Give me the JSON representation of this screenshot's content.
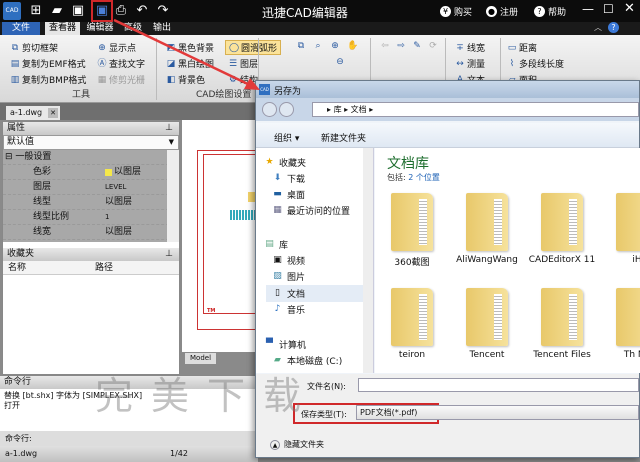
{
  "app": {
    "title": "迅捷CAD编辑器",
    "logo": "CAD",
    "buy": "购买",
    "register": "注册",
    "help": "帮助"
  },
  "quick_access": [
    "new-icon",
    "open-icon",
    "save-icon",
    "save-as-icon",
    "print-icon",
    "undo-icon",
    "redo-icon"
  ],
  "tabs": [
    "文件",
    "查看器",
    "编辑器",
    "高级",
    "输出"
  ],
  "ribbon": {
    "tools": {
      "label": "工具",
      "items": [
        "剪切框架",
        "显示点",
        "复制为EMF格式",
        "查找文字",
        "复制为BMP格式",
        "修剪光栅"
      ]
    },
    "cad_settings": {
      "label": "CAD绘图设置",
      "items": [
        "黑色背景",
        "圆滑弧形",
        "黑白绘图",
        "图层",
        "背景色",
        "结构"
      ]
    },
    "line_tools": [
      "线宽",
      "测量",
      "文本"
    ],
    "measure_tools": [
      "距离",
      "多段线长度",
      "面积"
    ]
  },
  "document_tab": "a-1.dwg",
  "properties": {
    "title": "属性",
    "dropdown": "默认值",
    "section": "一般设置",
    "rows": [
      {
        "name": "色彩",
        "value": "以图层"
      },
      {
        "name": "图层",
        "value": "LEVEL"
      },
      {
        "name": "线型",
        "value": "以图层"
      },
      {
        "name": "线型比例",
        "value": "1"
      },
      {
        "name": "线宽",
        "value": "以图层"
      }
    ]
  },
  "favorites": {
    "title": "收藏夹",
    "col_name": "名称",
    "col_path": "路径"
  },
  "drawing": {
    "model_tab": "Model",
    "stamp": "TM"
  },
  "command": {
    "title": "命令行",
    "lines": [
      "替换 [bt.shx] 字体为 [SIMPLEX.SHX]",
      "打开"
    ],
    "prompt": "命令行:"
  },
  "status": {
    "file": "a-1.dwg",
    "page": "1/42"
  },
  "watermark": "完美下载",
  "dialog": {
    "title": "另存为",
    "logo": "CAD",
    "breadcrumb": [
      "库",
      "文档"
    ],
    "organize": "组织 ▾",
    "new_folder": "新建文件夹",
    "nav": {
      "favorites": "收藏夹",
      "downloads": "下载",
      "desktop": "桌面",
      "recent": "最近访问的位置",
      "libraries": "库",
      "videos": "视频",
      "pictures": "图片",
      "documents": "文档",
      "music": "音乐",
      "computer": "计算机",
      "local_disk": "本地磁盘 (C:)"
    },
    "library_title": "文档库",
    "library_sub_label": "包括:",
    "library_sub_link": "2 个位置",
    "folders": [
      "360截图",
      "AliWangWang",
      "CADEditorX 11",
      "iH",
      "teiron",
      "Tencent",
      "Tencent Files",
      "Th Ne"
    ],
    "filename_label": "文件名(N):",
    "filename_value": "",
    "savetype_label": "保存类型(T):",
    "savetype_value": "PDF文档(*.pdf)",
    "hide_folders": "隐藏文件夹"
  }
}
